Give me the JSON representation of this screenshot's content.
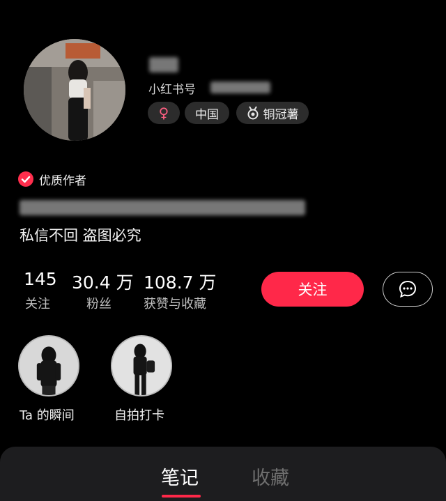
{
  "profile": {
    "id_label": "小红书号",
    "tags": {
      "gender_symbol": "♀",
      "region": "中国",
      "level": "铜冠薯"
    },
    "quality_author": "优质作者",
    "bio": "私信不回 盗图必究"
  },
  "stats": [
    {
      "value": "145",
      "label": "关注"
    },
    {
      "value": "30.4 万",
      "label": "粉丝"
    },
    {
      "value": "108.7 万",
      "label": "获赞与收藏"
    }
  ],
  "actions": {
    "follow_label": "关注"
  },
  "highlights": [
    {
      "label": "Ta 的瞬间"
    },
    {
      "label": "自拍打卡"
    }
  ],
  "tabs": [
    {
      "label": "笔记",
      "active": true
    },
    {
      "label": "收藏",
      "active": false
    }
  ],
  "colors": {
    "accent": "#ff2849",
    "female": "#ff5f82",
    "background": "#000000",
    "tag_bg": "#2c2c2c"
  },
  "icons": {
    "verified": "check-badge-icon",
    "level": "medal-icon",
    "message": "chat-bubble-icon"
  }
}
